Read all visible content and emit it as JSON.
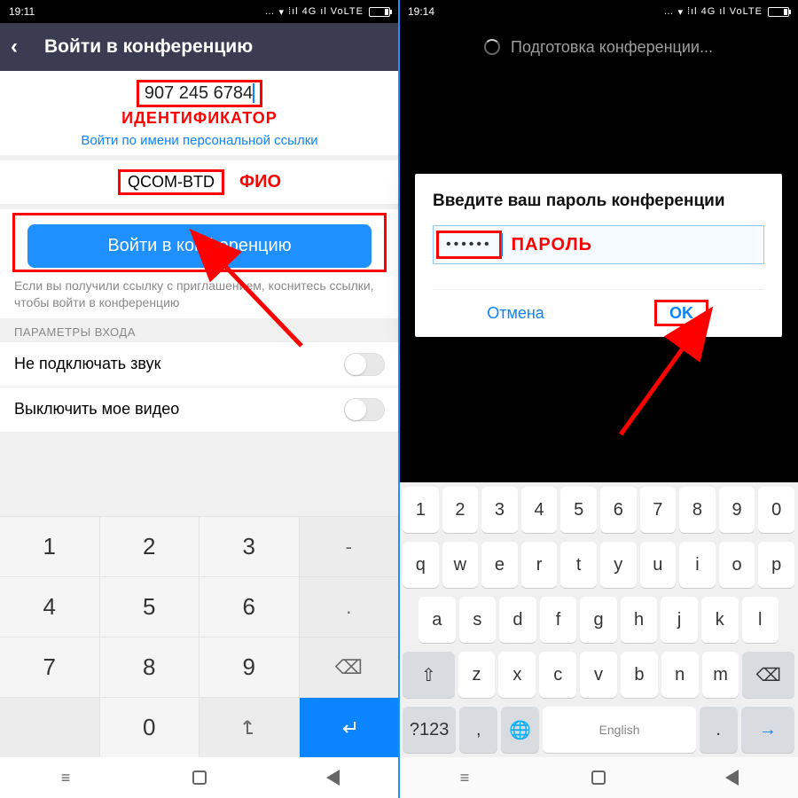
{
  "left": {
    "status_time": "19:11",
    "status_net": "4G",
    "status_volte": "VoLTE",
    "title": "Войти в конференцию",
    "id_value": "907 245 6784",
    "anno_id": "ИДЕНТИФИКАТОР",
    "personal_link": "Войти по имени персональной ссылки",
    "name_value": "QCOM-BTD",
    "anno_name": "ФИО",
    "join_btn": "Войти в конференцию",
    "hint": "Если вы получили ссылку с приглашением, коснитесь ссылки, чтобы войти в конференцию",
    "section": "ПАРАМЕТРЫ ВХОДА",
    "opt_audio": "Не подключать звук",
    "opt_video": "Выключить мое видео",
    "numpad": [
      "1",
      "2",
      "3",
      "-",
      "4",
      "5",
      "6",
      ".",
      "7",
      "8",
      "9",
      "⌫",
      " ",
      "0",
      "↓",
      "↵"
    ]
  },
  "right": {
    "status_time": "19:14",
    "status_net": "4G",
    "status_volte": "VoLTE",
    "title": "Подготовка конференции...",
    "dialog_title": "Введите ваш пароль конференции",
    "password_mask": "••••••",
    "anno_pw": "ПАРОЛЬ",
    "cancel": "Отмена",
    "ok": "OK",
    "row1": [
      "1",
      "2",
      "3",
      "4",
      "5",
      "6",
      "7",
      "8",
      "9",
      "0"
    ],
    "row2": [
      "q",
      "w",
      "e",
      "r",
      "t",
      "y",
      "u",
      "i",
      "o",
      "p"
    ],
    "row3": [
      "a",
      "s",
      "d",
      "f",
      "g",
      "h",
      "j",
      "k",
      "l"
    ],
    "row4_mid": [
      "z",
      "x",
      "c",
      "v",
      "b",
      "n",
      "m"
    ],
    "shift": "⇧",
    "bksp": "⌫",
    "sym": "?123",
    "comma": ",",
    "globe": "🌐",
    "space": "English",
    "period": ".",
    "enter": "→"
  }
}
